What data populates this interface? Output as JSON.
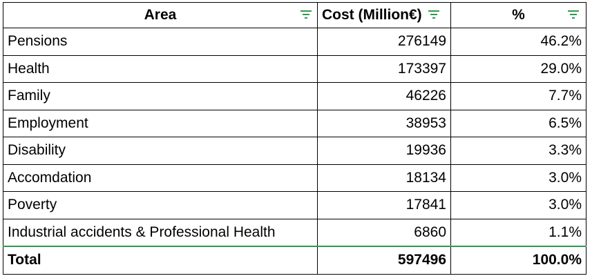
{
  "table": {
    "headers": [
      "Area",
      "Cost (Million€)",
      "%"
    ],
    "rows": [
      [
        "Pensions",
        "276149",
        "46.2%"
      ],
      [
        "Health",
        "173397",
        "29.0%"
      ],
      [
        "Family",
        "46226",
        "7.7%"
      ],
      [
        "Employment",
        "38953",
        "6.5%"
      ],
      [
        "Disability",
        "19936",
        "3.3%"
      ],
      [
        "Accomdation",
        "18134",
        "3.0%"
      ],
      [
        "Poverty",
        "17841",
        "3.0%"
      ],
      [
        "Industrial accidents & Professional Health",
        "6860",
        "1.1%"
      ]
    ],
    "total": [
      "Total",
      "597496",
      "100.0%"
    ]
  },
  "colors": {
    "filter_icon": "#2e9a4f",
    "border": "#000000",
    "separator": "#2e9a4f"
  },
  "icons": {
    "header_filter": "filter-icon"
  }
}
